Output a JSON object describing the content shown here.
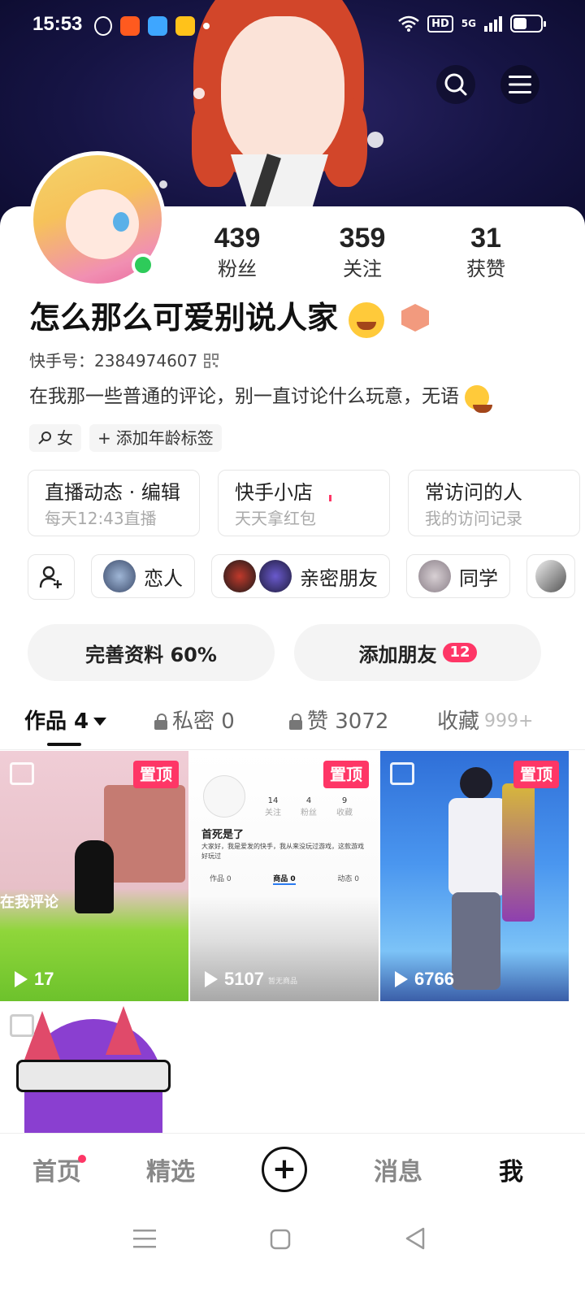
{
  "status_bar": {
    "time": "15:53",
    "network": "5G",
    "hd": "HD"
  },
  "profile": {
    "nickname": "怎么那么可爱别说人家",
    "kuaishou_id_label": "快手号：",
    "kuaishou_id": "2384974607",
    "bio": "在我那一些普通的评论，别一直讨论什么玩意，无语",
    "online": true
  },
  "stats": [
    {
      "value": "439",
      "label": "粉丝"
    },
    {
      "value": "359",
      "label": "关注"
    },
    {
      "value": "31",
      "label": "获赞"
    }
  ],
  "tags": [
    {
      "icon": "female-icon",
      "label": "女"
    },
    {
      "icon": "plus-icon",
      "label": "添加年龄标签"
    }
  ],
  "features": [
    {
      "title": "直播动态 · 编辑",
      "subtitle": "每天12:43直播"
    },
    {
      "title": "快手小店",
      "subtitle": "天天拿红包"
    },
    {
      "title": "常访问的人",
      "subtitle": "我的访问记录"
    }
  ],
  "circles": [
    {
      "label": "恋人"
    },
    {
      "label": "亲密朋友"
    },
    {
      "label": "同学"
    }
  ],
  "actions": {
    "complete_profile": "完善资料 60%",
    "add_friends": "添加朋友",
    "add_friends_badge": "12"
  },
  "tabs": [
    {
      "label": "作品 4",
      "active": true
    },
    {
      "label": "私密 0",
      "locked": true
    },
    {
      "label": "赞 3072",
      "locked": true
    },
    {
      "label": "收藏",
      "count": "999+"
    }
  ],
  "works": [
    {
      "pinned_label": "置顶",
      "plays": "17",
      "overlay": "在我评论"
    },
    {
      "pinned_label": "置顶",
      "plays": "5107",
      "inner": {
        "name": "首死是了",
        "desc": "大家好，我是爱发的快手，我从来没玩过游戏，这款游戏好玩过",
        "stats": [
          {
            "n": "14",
            "l": "关注"
          },
          {
            "n": "4",
            "l": "粉丝"
          },
          {
            "n": "9",
            "l": "收藏"
          }
        ],
        "tabs": [
          "作品 0",
          "商品 0",
          "动态 0"
        ],
        "empty": "暂无商品"
      }
    },
    {
      "pinned_label": "置顶",
      "plays": "6766"
    },
    {}
  ],
  "bottom_nav": [
    "首页",
    "精选",
    "消息",
    "我"
  ],
  "colors": {
    "accent": "#fe3666",
    "online": "#2ecb5a",
    "banner": "#161444"
  }
}
